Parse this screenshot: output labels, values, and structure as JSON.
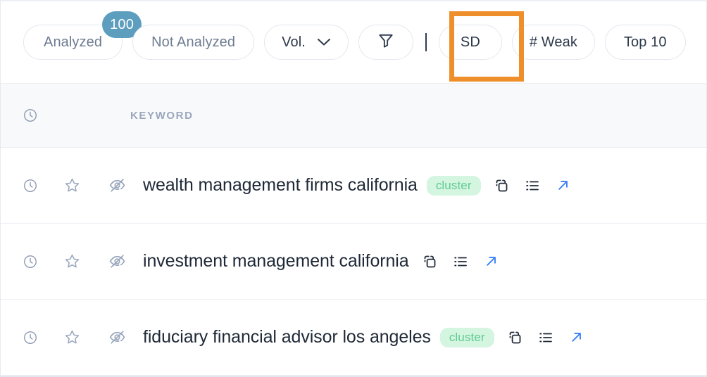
{
  "toolbar": {
    "filters": [
      {
        "id": "analyzed",
        "label": "Analyzed",
        "badge": "100",
        "badge_color": "#5d9dbe",
        "style": "muted"
      },
      {
        "id": "not-analyzed",
        "label": "Not Analyzed",
        "badge": null,
        "style": "muted"
      },
      {
        "id": "vol",
        "label": "Vol.",
        "badge": null,
        "icon": "chevron-down-icon",
        "style": "dark"
      }
    ],
    "filter_icon": "filter-funnel-icon",
    "separator": "|",
    "right_filters": [
      {
        "id": "sd",
        "label": "SD",
        "highlighted": true
      },
      {
        "id": "weak",
        "label": "# Weak",
        "highlighted": false
      },
      {
        "id": "top10",
        "label": "Top 10",
        "highlighted": false
      }
    ],
    "highlight_color": "#ef8f2b"
  },
  "table": {
    "header": {
      "clock_icon": "clock-icon",
      "keyword_column": "KEYWORD"
    },
    "rows": [
      {
        "clock_icon": "clock-icon",
        "star_icon": "star-outline-icon",
        "hide_icon": "eye-off-icon",
        "keyword": "wealth management firms california",
        "badge": "cluster",
        "actions": [
          "copy-icon",
          "list-icon",
          "external-link-icon"
        ]
      },
      {
        "clock_icon": "clock-icon",
        "star_icon": "star-outline-icon",
        "hide_icon": "eye-off-icon",
        "keyword": "investment management california",
        "badge": null,
        "actions": [
          "copy-icon",
          "list-icon",
          "external-link-icon"
        ]
      },
      {
        "clock_icon": "clock-icon",
        "star_icon": "star-outline-icon",
        "hide_icon": "eye-off-icon",
        "keyword": "fiduciary financial advisor los angeles",
        "badge": "cluster",
        "actions": [
          "copy-icon",
          "list-icon",
          "external-link-icon"
        ]
      }
    ]
  },
  "colors": {
    "badge_cluster_bg": "#d4f5e0",
    "badge_cluster_text": "#5fcb92",
    "external_link": "#3b82f6",
    "header_text": "#9aa7bd"
  }
}
